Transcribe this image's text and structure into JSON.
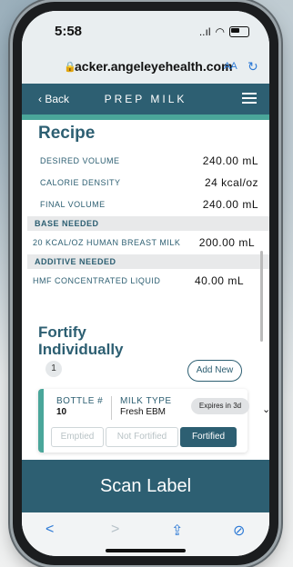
{
  "status": {
    "time": "5:58",
    "signal": "..ıl",
    "wifi": "◠"
  },
  "browser": {
    "url": "acker.angeleyehealth.com",
    "text_size": "AA"
  },
  "appbar": {
    "back": "Back",
    "title": "PREP MILK"
  },
  "recipe": {
    "heading": "Recipe",
    "rows": [
      {
        "label": "DESIRED VOLUME",
        "value": "240.00 mL"
      },
      {
        "label": "CALORIE DENSITY",
        "value": "24 kcal/oz"
      },
      {
        "label": "FINAL VOLUME",
        "value": "240.00 mL"
      }
    ],
    "base_header": "BASE NEEDED",
    "base_row": {
      "label": "20 KCAL/OZ HUMAN BREAST MILK",
      "value": "200.00 mL"
    },
    "additive_header": "ADDITIVE NEEDED",
    "additive_row": {
      "label": "HMF CONCENTRATED LIQUID",
      "value": "40.00 mL"
    }
  },
  "fortify": {
    "heading_line1": "Fortify",
    "heading_line2": "Individually",
    "count": "1",
    "add_new": "Add New",
    "card": {
      "bottle_label": "BOTTLE #",
      "bottle_value": "10",
      "milk_type_label": "MILK TYPE",
      "milk_type_value": "Fresh EBM",
      "expires": "Expires in 3d",
      "options": [
        "Emptied",
        "Not Fortified",
        "Fortified"
      ],
      "selected": "Fortified"
    }
  },
  "scan_label": "Scan Label",
  "toolbar": {
    "back": "<",
    "forward": ">",
    "share": "⇪",
    "compass": "⊘"
  }
}
